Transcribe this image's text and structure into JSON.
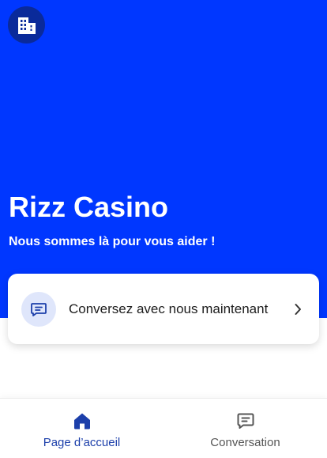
{
  "header": {
    "logo_icon": "building-icon",
    "title": "Rizz Casino",
    "subtitle": "Nous sommes là pour vous aider !"
  },
  "card": {
    "icon": "chat-icon",
    "label": "Conversez avec nous maintenant",
    "chevron_icon": "chevron-right-icon"
  },
  "bottom_nav": {
    "items": [
      {
        "label": "Page d’accueil",
        "icon": "home-icon",
        "active": true
      },
      {
        "label": "Conversation",
        "icon": "chat-icon",
        "active": false
      }
    ]
  },
  "colors": {
    "brand": "#0037ff",
    "logo_background": "#0a2a9a",
    "card_icon_background": "#dfe6fb",
    "active_nav": "#1c3faa",
    "inactive_nav": "#555555"
  }
}
